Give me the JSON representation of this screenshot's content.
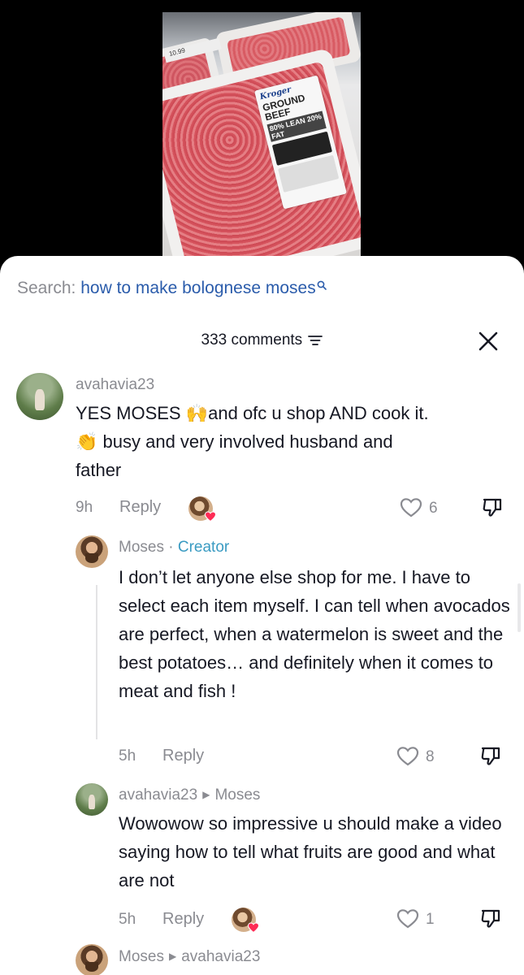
{
  "search": {
    "prefix": "Search: ",
    "query": "how to make bolognese moses"
  },
  "comments_header": {
    "count_label": "333 comments"
  },
  "comments": [
    {
      "username": "avahavia23",
      "text_line1_a": "YES MOSES ",
      "emoji1": "🙌",
      "text_line1_b": "and ofc u shop AND cook it.",
      "emoji2": "👏",
      "text_line2": " busy and very involved husband and",
      "text_line3": "father",
      "time": "9h",
      "reply_label": "Reply",
      "likes": "6"
    },
    {
      "username": "Moses",
      "separator": " · ",
      "badge": "Creator",
      "text": "I don’t let anyone else shop for me. I have to select each item myself. I can tell when avocados are perfect, when a watermelon is sweet and the best potatoes… and definitely when it comes to meat and fish !",
      "time": "5h",
      "reply_label": "Reply",
      "likes": "8"
    },
    {
      "username": "avahavia23",
      "reply_to": "Moses",
      "text": "Wowowow so impressive u should make a video saying how to tell what fruits are good and what are not",
      "time": "5h",
      "reply_label": "Reply",
      "likes": "1"
    },
    {
      "username": "Moses",
      "reply_to": "avahavia23"
    }
  ],
  "video": {
    "brand": "Kroger",
    "product": "GROUND BEEF",
    "lean": "80% LEAN 20% FAT",
    "price": "10.99"
  },
  "colors": {
    "link": "#2b5cab",
    "creator": "#3a9bc2",
    "muted": "#8a8b91",
    "heart": "#fe2c55"
  }
}
